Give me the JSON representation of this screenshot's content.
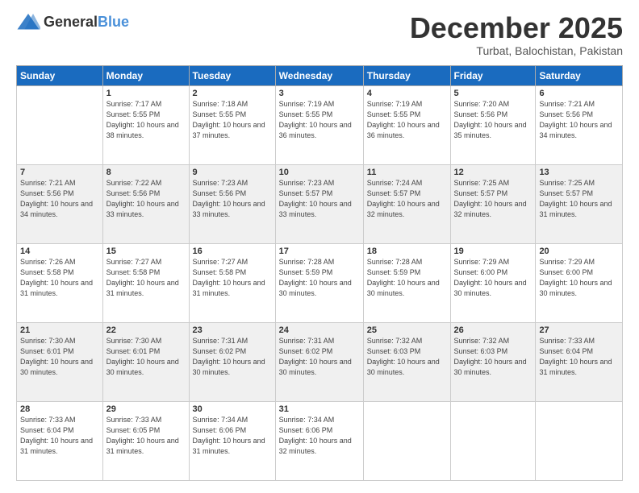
{
  "header": {
    "logo": {
      "general": "General",
      "blue": "Blue"
    },
    "title": "December 2025",
    "location": "Turbat, Balochistan, Pakistan"
  },
  "calendar": {
    "days_of_week": [
      "Sunday",
      "Monday",
      "Tuesday",
      "Wednesday",
      "Thursday",
      "Friday",
      "Saturday"
    ],
    "weeks": [
      [
        {
          "day": "",
          "sunrise": "",
          "sunset": "",
          "daylight": ""
        },
        {
          "day": "1",
          "sunrise": "Sunrise: 7:17 AM",
          "sunset": "Sunset: 5:55 PM",
          "daylight": "Daylight: 10 hours and 38 minutes."
        },
        {
          "day": "2",
          "sunrise": "Sunrise: 7:18 AM",
          "sunset": "Sunset: 5:55 PM",
          "daylight": "Daylight: 10 hours and 37 minutes."
        },
        {
          "day": "3",
          "sunrise": "Sunrise: 7:19 AM",
          "sunset": "Sunset: 5:55 PM",
          "daylight": "Daylight: 10 hours and 36 minutes."
        },
        {
          "day": "4",
          "sunrise": "Sunrise: 7:19 AM",
          "sunset": "Sunset: 5:55 PM",
          "daylight": "Daylight: 10 hours and 36 minutes."
        },
        {
          "day": "5",
          "sunrise": "Sunrise: 7:20 AM",
          "sunset": "Sunset: 5:56 PM",
          "daylight": "Daylight: 10 hours and 35 minutes."
        },
        {
          "day": "6",
          "sunrise": "Sunrise: 7:21 AM",
          "sunset": "Sunset: 5:56 PM",
          "daylight": "Daylight: 10 hours and 34 minutes."
        }
      ],
      [
        {
          "day": "7",
          "sunrise": "Sunrise: 7:21 AM",
          "sunset": "Sunset: 5:56 PM",
          "daylight": "Daylight: 10 hours and 34 minutes."
        },
        {
          "day": "8",
          "sunrise": "Sunrise: 7:22 AM",
          "sunset": "Sunset: 5:56 PM",
          "daylight": "Daylight: 10 hours and 33 minutes."
        },
        {
          "day": "9",
          "sunrise": "Sunrise: 7:23 AM",
          "sunset": "Sunset: 5:56 PM",
          "daylight": "Daylight: 10 hours and 33 minutes."
        },
        {
          "day": "10",
          "sunrise": "Sunrise: 7:23 AM",
          "sunset": "Sunset: 5:57 PM",
          "daylight": "Daylight: 10 hours and 33 minutes."
        },
        {
          "day": "11",
          "sunrise": "Sunrise: 7:24 AM",
          "sunset": "Sunset: 5:57 PM",
          "daylight": "Daylight: 10 hours and 32 minutes."
        },
        {
          "day": "12",
          "sunrise": "Sunrise: 7:25 AM",
          "sunset": "Sunset: 5:57 PM",
          "daylight": "Daylight: 10 hours and 32 minutes."
        },
        {
          "day": "13",
          "sunrise": "Sunrise: 7:25 AM",
          "sunset": "Sunset: 5:57 PM",
          "daylight": "Daylight: 10 hours and 31 minutes."
        }
      ],
      [
        {
          "day": "14",
          "sunrise": "Sunrise: 7:26 AM",
          "sunset": "Sunset: 5:58 PM",
          "daylight": "Daylight: 10 hours and 31 minutes."
        },
        {
          "day": "15",
          "sunrise": "Sunrise: 7:27 AM",
          "sunset": "Sunset: 5:58 PM",
          "daylight": "Daylight: 10 hours and 31 minutes."
        },
        {
          "day": "16",
          "sunrise": "Sunrise: 7:27 AM",
          "sunset": "Sunset: 5:58 PM",
          "daylight": "Daylight: 10 hours and 31 minutes."
        },
        {
          "day": "17",
          "sunrise": "Sunrise: 7:28 AM",
          "sunset": "Sunset: 5:59 PM",
          "daylight": "Daylight: 10 hours and 30 minutes."
        },
        {
          "day": "18",
          "sunrise": "Sunrise: 7:28 AM",
          "sunset": "Sunset: 5:59 PM",
          "daylight": "Daylight: 10 hours and 30 minutes."
        },
        {
          "day": "19",
          "sunrise": "Sunrise: 7:29 AM",
          "sunset": "Sunset: 6:00 PM",
          "daylight": "Daylight: 10 hours and 30 minutes."
        },
        {
          "day": "20",
          "sunrise": "Sunrise: 7:29 AM",
          "sunset": "Sunset: 6:00 PM",
          "daylight": "Daylight: 10 hours and 30 minutes."
        }
      ],
      [
        {
          "day": "21",
          "sunrise": "Sunrise: 7:30 AM",
          "sunset": "Sunset: 6:01 PM",
          "daylight": "Daylight: 10 hours and 30 minutes."
        },
        {
          "day": "22",
          "sunrise": "Sunrise: 7:30 AM",
          "sunset": "Sunset: 6:01 PM",
          "daylight": "Daylight: 10 hours and 30 minutes."
        },
        {
          "day": "23",
          "sunrise": "Sunrise: 7:31 AM",
          "sunset": "Sunset: 6:02 PM",
          "daylight": "Daylight: 10 hours and 30 minutes."
        },
        {
          "day": "24",
          "sunrise": "Sunrise: 7:31 AM",
          "sunset": "Sunset: 6:02 PM",
          "daylight": "Daylight: 10 hours and 30 minutes."
        },
        {
          "day": "25",
          "sunrise": "Sunrise: 7:32 AM",
          "sunset": "Sunset: 6:03 PM",
          "daylight": "Daylight: 10 hours and 30 minutes."
        },
        {
          "day": "26",
          "sunrise": "Sunrise: 7:32 AM",
          "sunset": "Sunset: 6:03 PM",
          "daylight": "Daylight: 10 hours and 30 minutes."
        },
        {
          "day": "27",
          "sunrise": "Sunrise: 7:33 AM",
          "sunset": "Sunset: 6:04 PM",
          "daylight": "Daylight: 10 hours and 31 minutes."
        }
      ],
      [
        {
          "day": "28",
          "sunrise": "Sunrise: 7:33 AM",
          "sunset": "Sunset: 6:04 PM",
          "daylight": "Daylight: 10 hours and 31 minutes."
        },
        {
          "day": "29",
          "sunrise": "Sunrise: 7:33 AM",
          "sunset": "Sunset: 6:05 PM",
          "daylight": "Daylight: 10 hours and 31 minutes."
        },
        {
          "day": "30",
          "sunrise": "Sunrise: 7:34 AM",
          "sunset": "Sunset: 6:06 PM",
          "daylight": "Daylight: 10 hours and 31 minutes."
        },
        {
          "day": "31",
          "sunrise": "Sunrise: 7:34 AM",
          "sunset": "Sunset: 6:06 PM",
          "daylight": "Daylight: 10 hours and 32 minutes."
        },
        {
          "day": "",
          "sunrise": "",
          "sunset": "",
          "daylight": ""
        },
        {
          "day": "",
          "sunrise": "",
          "sunset": "",
          "daylight": ""
        },
        {
          "day": "",
          "sunrise": "",
          "sunset": "",
          "daylight": ""
        }
      ]
    ]
  }
}
